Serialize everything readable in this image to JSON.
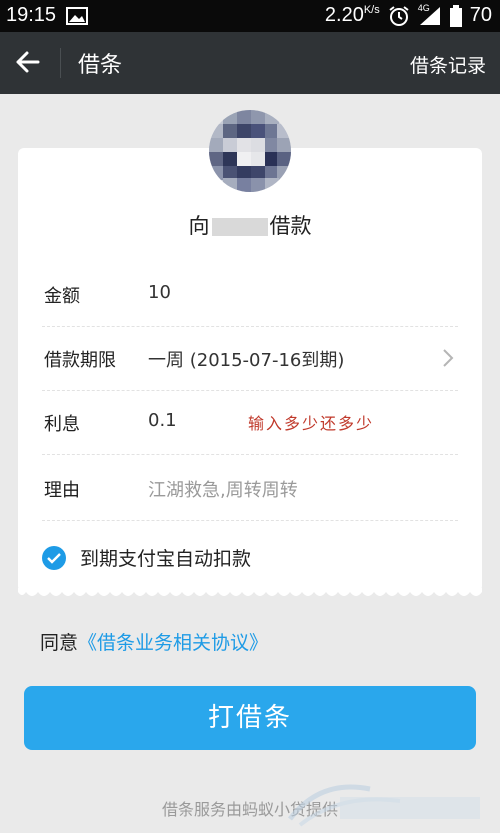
{
  "status_bar": {
    "time": "19:15",
    "network_speed": "2.20",
    "network_unit": "K/s",
    "signal": "4G",
    "battery": "70"
  },
  "nav": {
    "title": "借条",
    "record_link": "借条记录"
  },
  "card": {
    "borrow_prefix": "向",
    "borrow_suffix": "借款",
    "fields": [
      {
        "label": "金额",
        "value": "10"
      },
      {
        "label": "借款期限",
        "value": "一周 (2015-07-16到期)"
      },
      {
        "label": "利息",
        "value": "0.1",
        "annotation": "输入多少还多少"
      },
      {
        "label": "理由",
        "placeholder": "江湖救急,周转周转"
      }
    ],
    "auto_debit_label": "到期支付宝自动扣款",
    "auto_debit_checked": true
  },
  "agreement": {
    "prefix": "同意",
    "link": "《借条业务相关协议》"
  },
  "submit_label": "打借条",
  "footer": "借条服务由蚂蚁小贷提供",
  "colors": {
    "accent": "#2aa7ec",
    "nav_bg": "#2f3336",
    "annotation": "#c0392b"
  }
}
